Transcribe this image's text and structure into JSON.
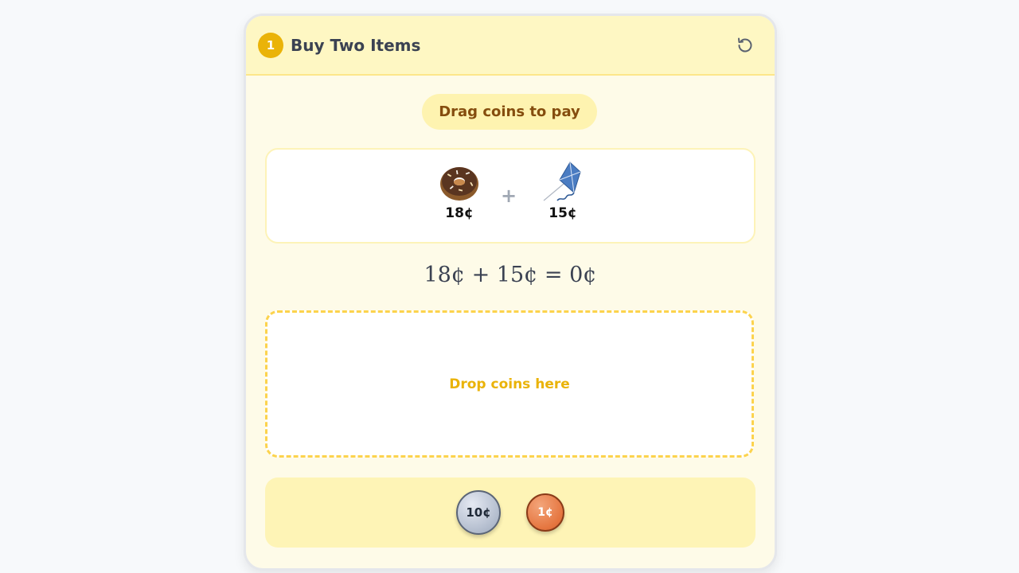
{
  "header": {
    "step_number": "1",
    "title": "Buy Two Items",
    "reset_icon": "reset-icon"
  },
  "instruction": "Drag coins to pay",
  "items": [
    {
      "name": "donut",
      "icon": "donut-icon",
      "price": "18¢"
    },
    {
      "name": "kite",
      "icon": "kite-icon",
      "price": "15¢"
    }
  ],
  "plus_symbol": "+",
  "equation": "18¢ + 15¢ = 0¢",
  "drop_zone": {
    "placeholder": "Drop coins here"
  },
  "coins": [
    {
      "label": "10¢",
      "value": 10
    },
    {
      "label": "1¢",
      "value": 1
    }
  ],
  "colors": {
    "accent": "#eab308",
    "header_bg": "#fef7c3",
    "card_bg": "#fefbe8",
    "drop_border": "#fcd34d"
  }
}
